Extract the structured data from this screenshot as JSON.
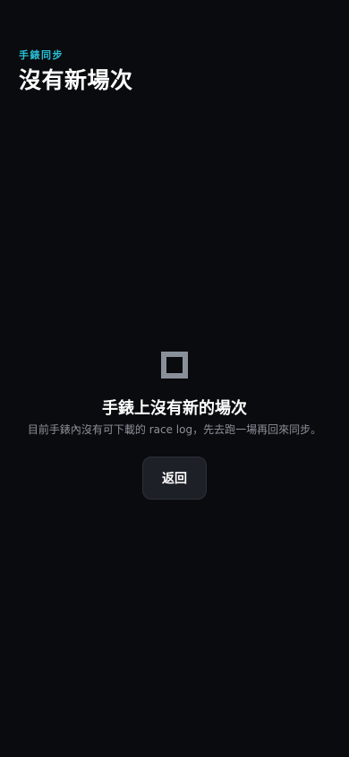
{
  "header": {
    "eyebrow": "手錶同步",
    "title": "沒有新場次"
  },
  "empty_state": {
    "icon": "empty-square-icon",
    "title": "手錶上沒有新的場次",
    "description": "目前手錶內沒有可下載的 race log，先去跑一場再回來同步。",
    "back_label": "返回"
  },
  "colors": {
    "background": "#0a0b0e",
    "accent": "#27c1d8",
    "muted_text": "#8b909a",
    "button_bg": "#1d2026",
    "icon_gray": "#8a9099"
  }
}
